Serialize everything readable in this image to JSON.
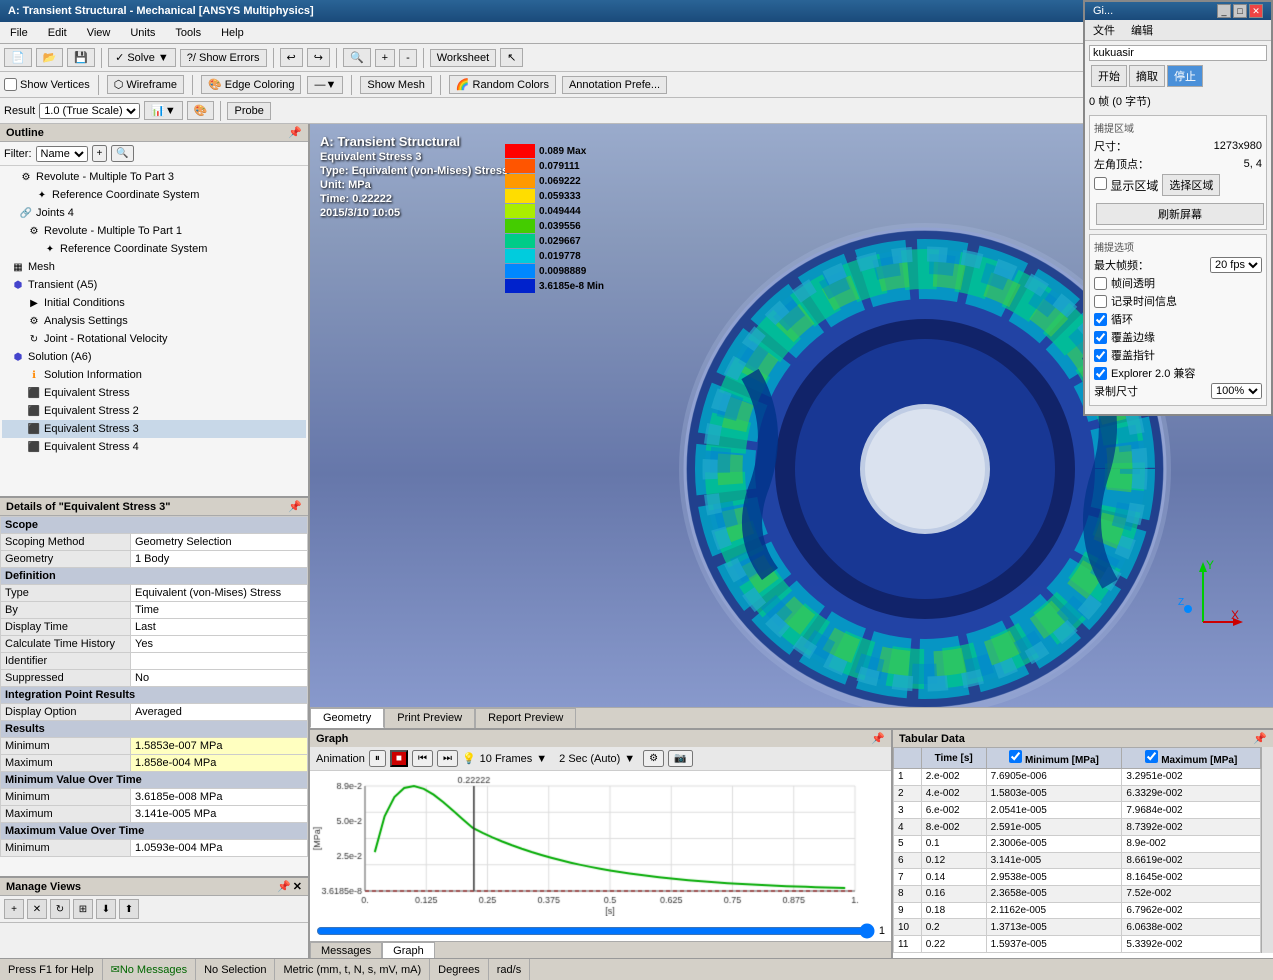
{
  "app": {
    "title": "A: Transient Structural - Mechanical [ANSYS Multiphysics]",
    "float_title": "Gi..."
  },
  "menu": {
    "items": [
      "File",
      "Edit",
      "View",
      "Units",
      "Tools",
      "Help"
    ]
  },
  "toolbar1": {
    "solve_label": "Solve",
    "show_errors_label": "?/ Show Errors",
    "worksheet_label": "Worksheet"
  },
  "toolbar2": {
    "show_vertices": "Show Vertices",
    "wireframe": "Wireframe",
    "edge_coloring": "Edge Coloring",
    "show_mesh": "Show Mesh",
    "random_colors": "Random Colors",
    "annotation_prefs": "Annotation Prefe..."
  },
  "toolbar3": {
    "result_label": "Result",
    "scale_label": "1.0 (True Scale)",
    "probe_label": "Probe"
  },
  "outline": {
    "title": "Outline",
    "filter_label": "Filter:",
    "filter_value": "Name",
    "items": [
      {
        "label": "Revolute - Multiple To Part 3",
        "level": 2,
        "icon": "gear"
      },
      {
        "label": "Reference Coordinate System",
        "level": 3,
        "icon": "coord"
      },
      {
        "label": "Joints 4",
        "level": 2,
        "icon": "joint"
      },
      {
        "label": "Revolute - Multiple To Part 1",
        "level": 3,
        "icon": "gear"
      },
      {
        "label": "Reference Coordinate System",
        "level": 4,
        "icon": "coord"
      },
      {
        "label": "Mesh",
        "level": 1,
        "icon": "mesh"
      },
      {
        "label": "Transient (A5)",
        "level": 1,
        "icon": "transient"
      },
      {
        "label": "Initial Conditions",
        "level": 2,
        "icon": "init"
      },
      {
        "label": "Analysis Settings",
        "level": 2,
        "icon": "settings"
      },
      {
        "label": "Joint - Rotational Velocity",
        "level": 2,
        "icon": "joint"
      },
      {
        "label": "Solution (A6)",
        "level": 1,
        "icon": "solution"
      },
      {
        "label": "Solution Information",
        "level": 2,
        "icon": "info"
      },
      {
        "label": "Equivalent Stress",
        "level": 2,
        "icon": "stress"
      },
      {
        "label": "Equivalent Stress 2",
        "level": 2,
        "icon": "stress"
      },
      {
        "label": "Equivalent Stress 3",
        "level": 2,
        "icon": "stress",
        "active": true
      },
      {
        "label": "Equivalent Stress 4",
        "level": 2,
        "icon": "stress"
      }
    ]
  },
  "details": {
    "title": "Details of \"Equivalent Stress 3\"",
    "sections": [
      {
        "name": "Scope",
        "rows": [
          {
            "label": "Scoping Method",
            "value": "Geometry Selection"
          },
          {
            "label": "Geometry",
            "value": "1 Body"
          }
        ]
      },
      {
        "name": "Definition",
        "rows": [
          {
            "label": "Type",
            "value": "Equivalent (von-Mises) Stress"
          },
          {
            "label": "By",
            "value": "Time"
          },
          {
            "label": "Display Time",
            "value": "Last"
          },
          {
            "label": "Calculate Time History",
            "value": "Yes"
          },
          {
            "label": "Identifier",
            "value": ""
          },
          {
            "label": "Suppressed",
            "value": "No"
          }
        ]
      },
      {
        "name": "Integration Point Results",
        "rows": [
          {
            "label": "Display Option",
            "value": "Averaged"
          }
        ]
      },
      {
        "name": "Results",
        "rows": [
          {
            "label": "Minimum",
            "value": "1.5853e-007 MPa",
            "highlight": true
          },
          {
            "label": "Maximum",
            "value": "1.858e-004 MPa",
            "highlight": true
          }
        ]
      },
      {
        "name": "Minimum Value Over Time",
        "rows": [
          {
            "label": "Minimum",
            "value": "3.6185e-008 MPa"
          },
          {
            "label": "Maximum",
            "value": "3.141e-005 MPa"
          }
        ]
      },
      {
        "name": "Maximum Value Over Time",
        "rows": [
          {
            "label": "Minimum",
            "value": "1.0593e-004 MPa"
          }
        ]
      }
    ]
  },
  "manage_views": {
    "title": "Manage Views"
  },
  "viewport": {
    "analysis_name": "A: Transient Structural",
    "result_name": "Equivalent Stress 3",
    "result_type": "Type: Equivalent (von-Mises) Stress",
    "unit": "Unit: MPa",
    "time": "Time: 0.22222",
    "date": "2015/3/10 10:05"
  },
  "legend": {
    "items": [
      {
        "label": "0.089 Max",
        "color": "#ff0000"
      },
      {
        "label": "0.079111",
        "color": "#ff4400"
      },
      {
        "label": "0.069222",
        "color": "#ff8800"
      },
      {
        "label": "0.059333",
        "color": "#ffcc00"
      },
      {
        "label": "0.049444",
        "color": "#ccff00"
      },
      {
        "label": "0.039556",
        "color": "#88ff00"
      },
      {
        "label": "0.029667",
        "color": "#00ff44"
      },
      {
        "label": "0.019778",
        "color": "#00ffcc"
      },
      {
        "label": "0.0098889",
        "color": "#00ccff"
      },
      {
        "label": "3.6185e-8 Min",
        "color": "#0044ff"
      }
    ]
  },
  "tabs": {
    "geometry": "Geometry",
    "print_preview": "Print Preview",
    "report_preview": "Report Preview"
  },
  "graph": {
    "title": "Graph",
    "animation_label": "Animation",
    "frames_label": "10 Frames",
    "duration_label": "2 Sec (Auto)",
    "x_axis": "[s]",
    "y_axis": "[MPa]",
    "time_marker": "0.22222",
    "y_max": "8.9e-2",
    "y_min": "3.6185e-8",
    "y_mid1": "5.0e-2",
    "y_mid2": "2.5e-2",
    "slider_value": "1",
    "tabs": [
      "Messages",
      "Graph"
    ]
  },
  "tabular": {
    "title": "Tabular Data",
    "headers": [
      "",
      "Time [s]",
      "Minimum [MPa]",
      "Maximum [MPa]"
    ],
    "rows": [
      {
        "idx": 1,
        "time": "2.e-002",
        "min": "7.6905e-006",
        "max": "3.2951e-002"
      },
      {
        "idx": 2,
        "time": "4.e-002",
        "min": "1.5803e-005",
        "max": "6.3329e-002"
      },
      {
        "idx": 3,
        "time": "6.e-002",
        "min": "2.0541e-005",
        "max": "7.9684e-002"
      },
      {
        "idx": 4,
        "time": "8.e-002",
        "min": "2.591e-005",
        "max": "8.7392e-002"
      },
      {
        "idx": 5,
        "time": "0.1",
        "min": "2.3006e-005",
        "max": "8.9e-002"
      },
      {
        "idx": 6,
        "time": "0.12",
        "min": "3.141e-005",
        "max": "8.6619e-002"
      },
      {
        "idx": 7,
        "time": "0.14",
        "min": "2.9538e-005",
        "max": "8.1645e-002"
      },
      {
        "idx": 8,
        "time": "0.16",
        "min": "2.3658e-005",
        "max": "7.52e-002"
      },
      {
        "idx": 9,
        "time": "0.18",
        "min": "2.1162e-005",
        "max": "6.7962e-002"
      },
      {
        "idx": 10,
        "time": "0.2",
        "min": "1.3713e-005",
        "max": "6.0638e-002"
      },
      {
        "idx": 11,
        "time": "0.22",
        "min": "1.5937e-005",
        "max": "5.3392e-002"
      }
    ]
  },
  "status_bar": {
    "f1_hint": "Press F1 for Help",
    "messages": "No Messages",
    "selection": "No Selection",
    "units": "Metric (mm, t, N, s, mV, mA)",
    "degrees": "Degrees",
    "rad_s": "rad/s"
  },
  "float_panel": {
    "title": "Gi...",
    "menu_items": [
      "文件",
      "编辑"
    ],
    "username": "kukuasir",
    "btn_start": "开始",
    "btn_extract": "摘取",
    "btn_stop": "停止",
    "frames_label": "0 帧 (0 字节)",
    "capture_section": "捕提区域",
    "size_label": "尺寸：",
    "size_value": "1273x980",
    "corner_label": "左角顶点：",
    "corner_value": "5, 4",
    "show_area_label": "显示区域",
    "select_area_label": "选择区域",
    "refresh_btn": "刷新屏幕",
    "options_section": "捕提选项",
    "fps_label": "最大帧频：",
    "fps_value": "20 fps",
    "transparent_label": "帧间透明",
    "record_time_label": "记录时间信息",
    "loop_label": "循环",
    "cover_edge_label": "覆盖边缘",
    "cover_cursor_label": "覆盖指针",
    "explorer_label": "Explorer 2.0 兼容",
    "record_size_label": "录制尺寸",
    "record_size_value": "100%"
  }
}
